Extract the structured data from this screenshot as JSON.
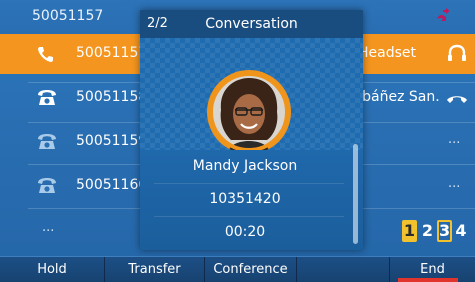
{
  "status_bar": {
    "account": "50051157",
    "missed_icon": "missed-call-icon",
    "missed_color": "#c2185b"
  },
  "lines": [
    {
      "label": "50051157",
      "icon": "phone-handset-icon",
      "active": true,
      "right_label": "Headset",
      "right_icon": "headset-icon"
    },
    {
      "label": "50051158",
      "icon": "desk-phone-icon",
      "active": false,
      "right_label": "Ibáñez San.",
      "right_icon": "hang-up-icon"
    },
    {
      "label": "50051159",
      "icon": "desk-phone-icon",
      "active": false,
      "right_label": "...",
      "right_icon": ""
    },
    {
      "label": "50051160",
      "icon": "desk-phone-icon",
      "active": false,
      "right_label": "...",
      "right_icon": ""
    }
  ],
  "more_label": "...",
  "pages": {
    "items": [
      "1",
      "2",
      "3",
      "4"
    ],
    "current": "1"
  },
  "popup": {
    "counter": "2/2",
    "title": "Conversation",
    "avatar_icon": "contact-photo",
    "name": "Mandy Jackson",
    "number": "10351420",
    "duration": "00:20"
  },
  "softkeys": [
    "Hold",
    "Transfer",
    "Conference",
    "",
    "End"
  ],
  "colors": {
    "accent": "#f4951f",
    "background": "#2a6fb3",
    "softkey_bar": "#17426f",
    "page_highlight": "#f2c12e",
    "end_underline": "#e0342c"
  }
}
